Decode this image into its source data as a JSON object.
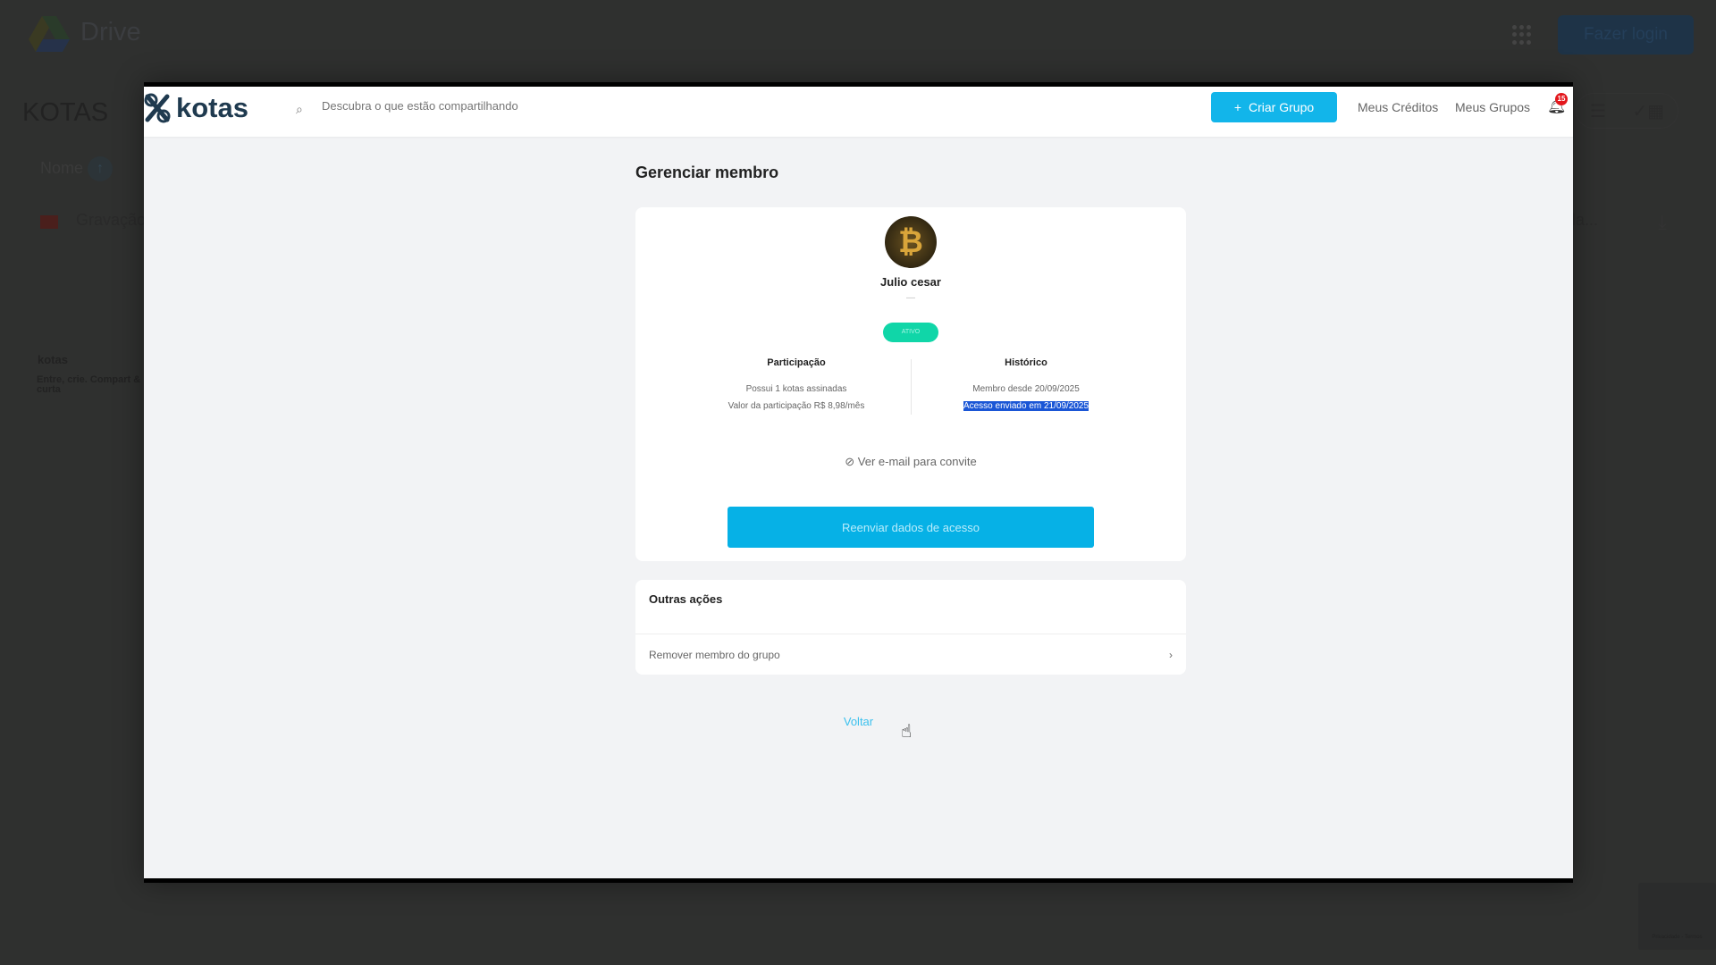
{
  "background": {
    "app_name": "Drive",
    "login_button": "Fazer login",
    "folder_title": "KOTAS",
    "sort_label": "Nome",
    "file_name": "Gravação",
    "file_name_right": "Tela...",
    "kotas_brand": "kotas",
    "kotas_tagline": "Entre, crie. Compart & curta",
    "recaptcha": "Privacidade - Termos"
  },
  "header": {
    "logo": "kotas",
    "search_placeholder": "Descubra o que estão compartilhando",
    "create_group": "Criar Grupo",
    "my_credits": "Meus Créditos",
    "my_groups": "Meus Grupos",
    "notification_count": "15"
  },
  "page": {
    "title": "Gerenciar membro",
    "member": {
      "name": "Julio cesar",
      "subtitle": "—",
      "status": "ATIVO",
      "participation_title": "Participação",
      "participation_lines": [
        "Possui 1 kotas assinadas",
        "Valor da participação R$ 8,98/mês"
      ],
      "history_title": "Histórico",
      "history_lines": [
        "Membro desde 20/09/2025",
        "Acesso enviado em 21/09/2025"
      ]
    },
    "view_email": "Ver e-mail para convite",
    "resend_button": "Reenviar dados de acesso",
    "other_actions_title": "Outras ações",
    "remove_member": "Remover membro do grupo",
    "back_link": "Voltar"
  },
  "colors": {
    "accent": "#12b5ea",
    "status": "#10d6a8",
    "badge": "#e3181d"
  }
}
